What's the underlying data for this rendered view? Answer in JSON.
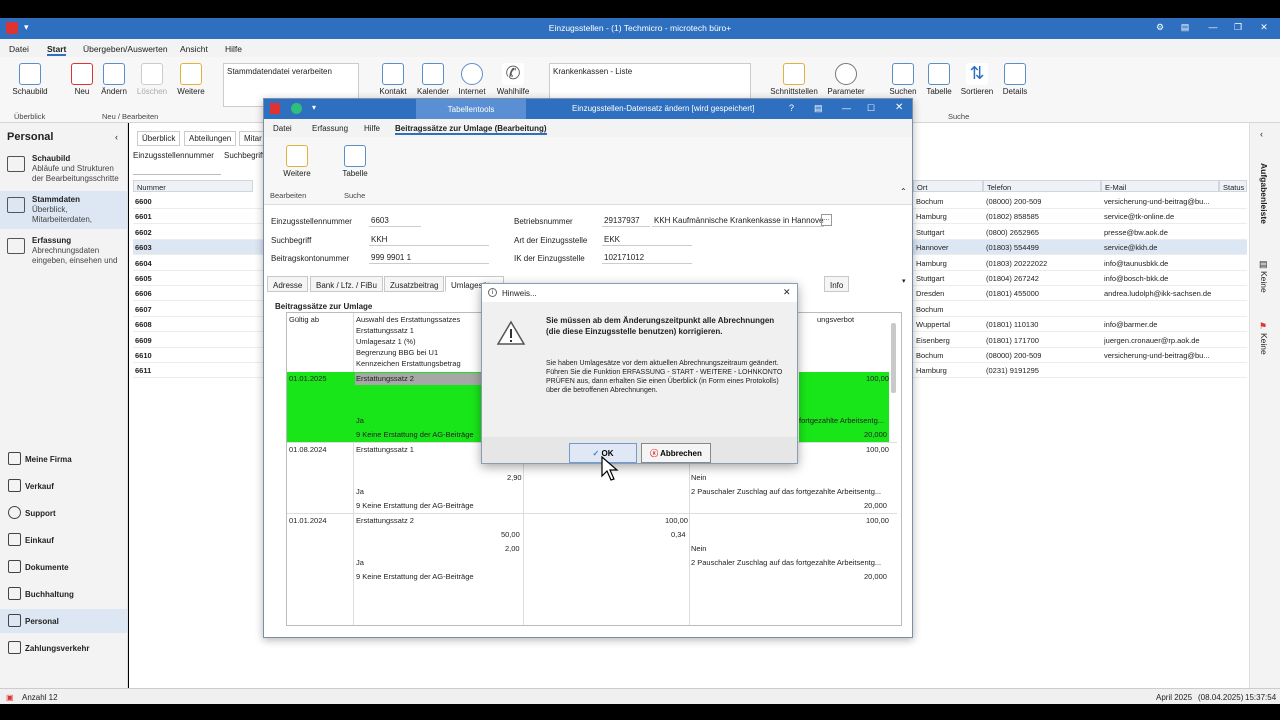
{
  "window": {
    "title": "Einzugsstellen - (1) Techmicro - microtech büro+"
  },
  "menu": [
    "Datei",
    "Start",
    "Übergeben/Auswerten",
    "Ansicht",
    "Hilfe"
  ],
  "ribbon": {
    "schaubild": "Schaubild",
    "ueberblick": "Überblick",
    "neu": "Neu",
    "aendern": "Ändern",
    "loeschen": "Löschen",
    "weitere": "Weitere",
    "group_neu": "Neu / Bearbeiten",
    "stammdaten": "Stammdatendatei verarbeiten",
    "kontakt": "Kontakt",
    "kalender": "Kalender",
    "internet": "Internet",
    "wahlhilfe": "Wahlhilfe",
    "list_sel": "Krankenkassen - Liste",
    "schnittstellen": "Schnittstellen",
    "parameter": "Parameter",
    "suchen": "Suchen",
    "tabelle": "Tabelle",
    "sortieren": "Sortieren",
    "details": "Details",
    "group_suche": "Suche"
  },
  "sidebar": {
    "title": "Personal",
    "items": [
      {
        "title": "Schaubild",
        "desc": "Abläufe und Strukturen der Bearbeitungsschritte"
      },
      {
        "title": "Stammdaten",
        "desc": "Überblick, Mitarbeiterdaten,"
      },
      {
        "title": "Erfassung",
        "desc": "Abrechnungsdaten eingeben, einsehen und"
      }
    ],
    "nav": [
      "Meine Firma",
      "Verkauf",
      "Support",
      "Einkauf",
      "Dokumente",
      "Buchhaltung",
      "Personal",
      "Zahlungsverkehr"
    ]
  },
  "main": {
    "tabs": [
      "Überblick",
      "Abteilungen",
      "Mitar"
    ],
    "filters": [
      "Einzugsstellennummer",
      "Suchbegriff"
    ],
    "columns": [
      "Nummer",
      "Ort",
      "Telefon",
      "E-Mail",
      "Status"
    ],
    "rows": [
      {
        "nr": "6600",
        "ort": "Bochum",
        "tel": "(08000) 200-509",
        "mail": "versicherung-und-beitrag@bu..."
      },
      {
        "nr": "6601",
        "ort": "Hamburg",
        "tel": "(01802) 858585",
        "mail": "service@tk-online.de"
      },
      {
        "nr": "6602",
        "ort": "Stuttgart",
        "tel": "(0800) 2652965",
        "mail": "presse@bw.aok.de"
      },
      {
        "nr": "6603",
        "ort": "Hannover",
        "tel": "(01803) 554499",
        "mail": "service@kkh.de"
      },
      {
        "nr": "6604",
        "ort": "Hamburg",
        "tel": "(01803) 20222022",
        "mail": "info@taunusbkk.de"
      },
      {
        "nr": "6605",
        "ort": "Stuttgart",
        "tel": "(01804) 267242",
        "mail": "info@bosch-bkk.de"
      },
      {
        "nr": "6606",
        "ort": "Dresden",
        "tel": "(01801) 455000",
        "mail": "andrea.ludolph@ikk-sachsen.de"
      },
      {
        "nr": "6607",
        "ort": "Bochum",
        "tel": "",
        "mail": ""
      },
      {
        "nr": "6608",
        "ort": "Wuppertal",
        "tel": "(01801) 110130",
        "mail": "info@barmer.de"
      },
      {
        "nr": "6609",
        "ort": "Eisenberg",
        "tel": "(01801) 171700",
        "mail": "juergen.cronauer@rp.aok.de"
      },
      {
        "nr": "6610",
        "ort": "Bochum",
        "tel": "(08000) 200-509",
        "mail": "versicherung-und-beitrag@bu..."
      },
      {
        "nr": "6611",
        "ort": "Hamburg",
        "tel": "(0231) 9191295",
        "mail": ""
      }
    ]
  },
  "right_panel": {
    "a": "Aufgabenleiste",
    "b": "Keine",
    "c": "Keine"
  },
  "status": {
    "count": "Anzahl 12",
    "period": "April 2025",
    "date": "(08.04.2025)",
    "time": "15:37:54"
  },
  "dialog": {
    "tools": "Tabellentools",
    "title": "Einzugsstellen-Datensatz ändern [wird gespeichert]",
    "menu": [
      "Datei",
      "Erfassung",
      "Hilfe",
      "Beitragssätze zur Umlage (Bearbeitung)"
    ],
    "weitere": "Weitere",
    "tabelle": "Tabelle",
    "bearbeiten": "Bearbeiten",
    "suche": "Suche",
    "fields": {
      "nr_lbl": "Einzugsstellennummer",
      "nr": "6603",
      "such_lbl": "Suchbegriff",
      "such": "KKH",
      "konto_lbl": "Beitragskontonummer",
      "konto": "999 9901 1",
      "betr_lbl": "Betriebsnummer",
      "betr": "29137937",
      "betr_name": "KKH Kaufmännische Krankenkasse in Hannover",
      "art_lbl": "Art der Einzugsstelle",
      "art": "EKK",
      "ik_lbl": "IK der Einzugsstelle",
      "ik": "102171012"
    },
    "tabs": [
      "Adresse",
      "Bank / Lfz. / FiBu",
      "Zusatzbeitrag",
      "Umlagesätze",
      "Info"
    ],
    "grid": {
      "title": "Beitragssätze zur Umlage",
      "col1": "Gültig ab",
      "col2": [
        "Auswahl des Erstattungssatzes",
        "Erstattungssatz 1",
        "Umlagesatz 1 (%)",
        "Begrenzung BBG bei U1",
        "Kennzeichen Erstattungsbetrag"
      ],
      "col4": "ungsverbot",
      "r1": {
        "date": "01.01.2025",
        "a": "Erstattungssatz 2",
        "b": "Ja",
        "c": "9 Keine Erstattung der AG-Beiträge",
        "v1": "100,00",
        "v2": "fortgezahlte Arbeitsentg...",
        "v3": "20,000"
      },
      "r2": {
        "date": "01.08.2024",
        "a": "Erstattungssatz 1",
        "n": "2,90",
        "b": "Ja",
        "c": "9 Keine Erstattung der AG-Beiträge",
        "v1": "100,00",
        "nein": "Nein",
        "v2": "2 Pauschaler Zuschlag auf das fortgezahlte Arbeitsentg...",
        "v3": "20,000"
      },
      "r3": {
        "date": "01.01.2024",
        "a": "Erstattungssatz 2",
        "n1": "50,00",
        "n2": "2,00",
        "m1": "100,00",
        "m2": "0,34",
        "b": "Ja",
        "c": "9 Keine Erstattung der AG-Beiträge",
        "v1": "100,00",
        "nein": "Nein",
        "v2": "2 Pauschaler Zuschlag auf das fortgezahlte Arbeitsentg...",
        "v3": "20,000"
      }
    }
  },
  "message": {
    "title": "Hinweis...",
    "bold": "Sie müssen ab dem Änderungszeitpunkt alle Abrechnungen (die diese Einzugsstelle benutzen) korrigieren.",
    "text": "Sie haben Umlagesätze vor dem aktuellen Abrechnungszeitraum geändert.\nFühren Sie die Funktion ERFASSUNG - START - WEITERE - LOHNKONTO PRÜFEN aus, dann erhalten Sie einen Überblick (in Form eines Protokolls) über die betroffenen Abrechnungen.",
    "ok": "OK",
    "cancel": "Abbrechen"
  }
}
